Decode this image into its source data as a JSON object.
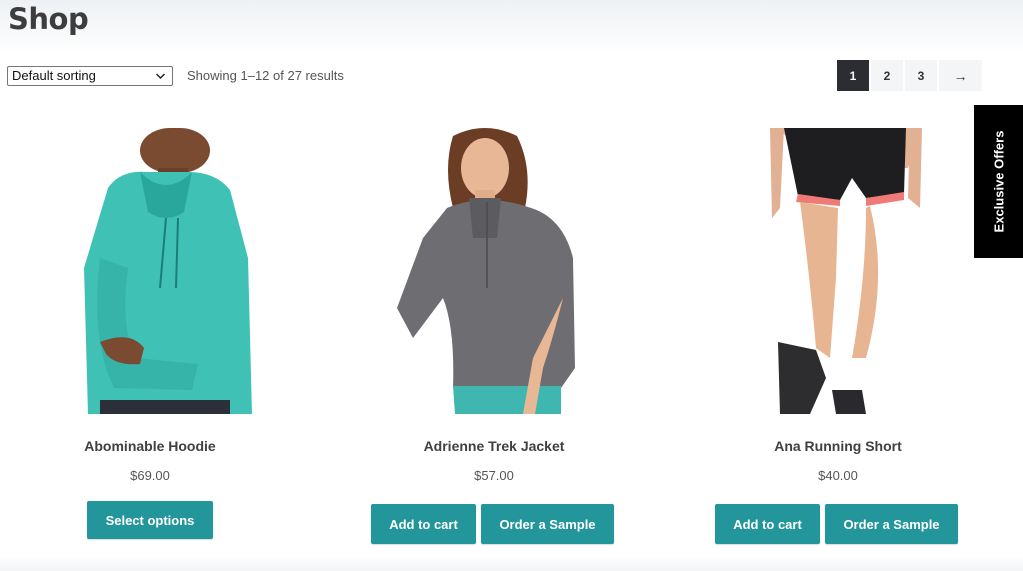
{
  "page": {
    "title": "Shop"
  },
  "toolbar": {
    "sort_selected": "Default sorting",
    "result_count": "Showing 1–12 of 27 results"
  },
  "pagination": {
    "pages": [
      "1",
      "2",
      "3"
    ],
    "current": "1",
    "next_label": "→"
  },
  "sidebar_tab": {
    "label": "Exclusive Offers"
  },
  "products": [
    {
      "name": "Abominable Hoodie",
      "price": "$69.00",
      "button": "Select options"
    },
    {
      "name": "Adrienne Trek Jacket",
      "price": "$57.00",
      "button": "Add to cart",
      "secondary_button": "Order a Sample"
    },
    {
      "name": "Ana Running Short",
      "price": "$40.00",
      "button": "Add to cart",
      "secondary_button": "Order a Sample"
    }
  ],
  "colors": {
    "accent_button": "#23969b",
    "pager_active": "#2c2d33",
    "offers_tab": "#000000"
  }
}
